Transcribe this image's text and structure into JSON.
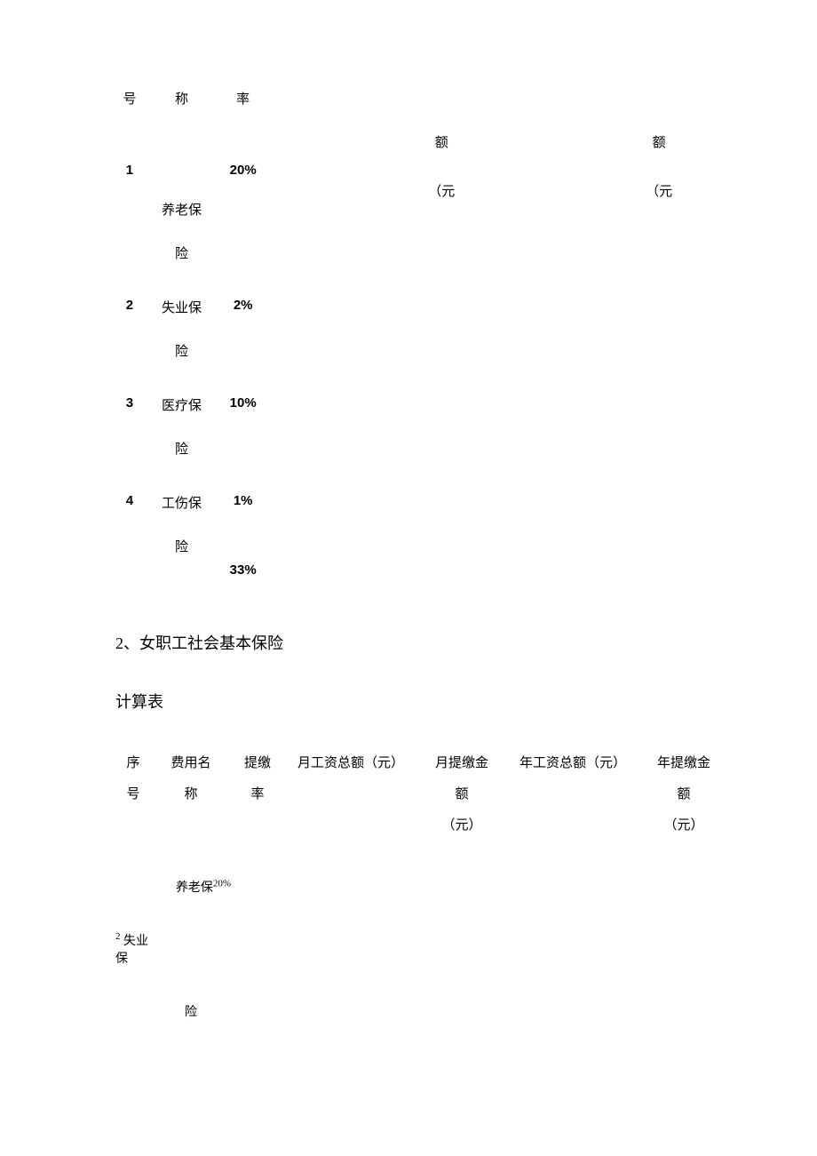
{
  "table1": {
    "headerFrag": {
      "col1_l2": "号",
      "col2_l2": "称",
      "col3_l2": "率",
      "col5_l2": "额",
      "col5_l3": "（元",
      "col7_l2": "额",
      "col7_l3": "（元"
    },
    "rows": [
      {
        "seq": "1",
        "name_l1": "养老保",
        "name_l2": "险",
        "rate": "20%"
      },
      {
        "seq": "2",
        "name_l1": "失业保",
        "name_l2": "险",
        "rate": "2%"
      },
      {
        "seq": "3",
        "name_l1": "医疗保",
        "name_l2": "险",
        "rate": "10%"
      },
      {
        "seq": "4",
        "name_l1": "工伤保",
        "name_l2": "险",
        "rate": "1%"
      }
    ],
    "totalRate": "33%"
  },
  "section2": {
    "title": "2、女职工社会基本保险",
    "sub": "计算表"
  },
  "table2": {
    "header": {
      "col1_l1": "序",
      "col1_l2": "号",
      "col2_l1": "费用名",
      "col2_l2": "称",
      "col3_l1": "提缴",
      "col3_l2": "率",
      "col4_l1": "月工资总额（元）",
      "col5_l1": "月提缴金",
      "col5_l2": "额",
      "col5_l3": "（元）",
      "col6_l1": "年工资总额（元）",
      "col7_l1": "年提缴金",
      "col7_l2": "额",
      "col7_l3": "（元）"
    },
    "row1": {
      "name": "养老保",
      "rate": "20%"
    },
    "row2": {
      "seq": "2",
      "name": "失业保",
      "name_l2": "险"
    }
  }
}
